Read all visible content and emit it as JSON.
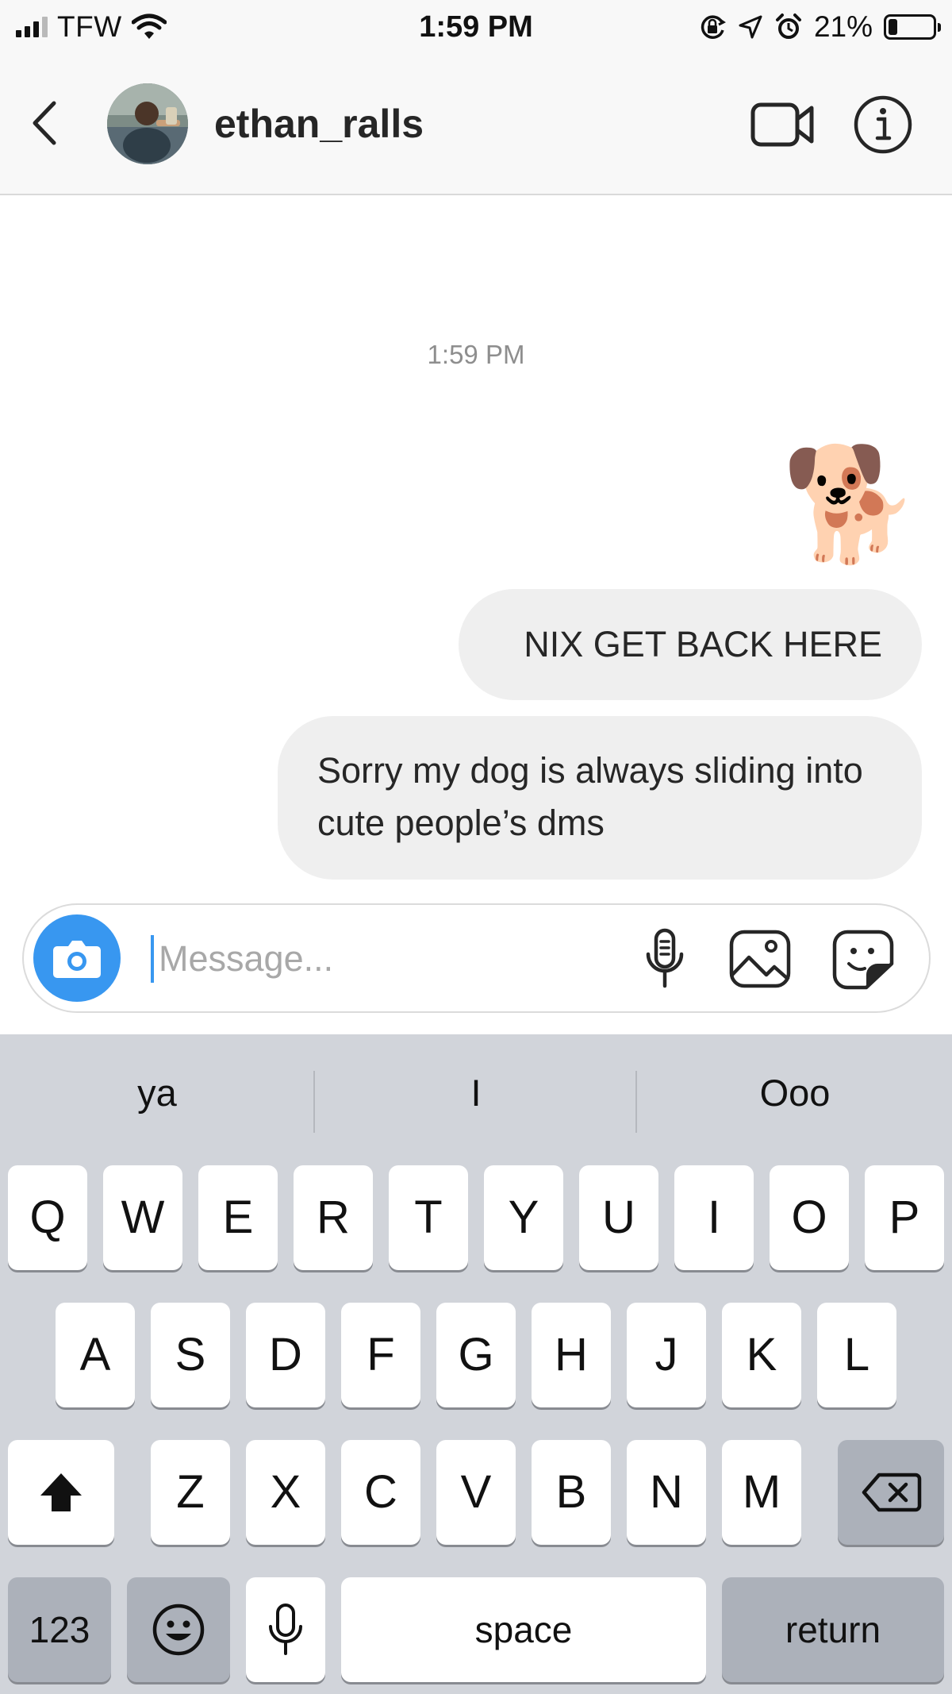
{
  "status_bar": {
    "carrier": "TFW",
    "time": "1:59 PM",
    "battery_percent": "21%",
    "battery_level": 0.21,
    "signal_bars": 3,
    "icons": [
      "wifi-icon",
      "orientation-lock-icon",
      "location-icon",
      "alarm-icon",
      "battery-icon"
    ]
  },
  "header": {
    "username": "ethan_ralls",
    "back_icon": "chevron-left-icon",
    "video_icon": "video-call-icon",
    "info_icon": "info-icon"
  },
  "chat": {
    "timestamp": "1:59 PM",
    "messages": [
      {
        "type": "emoji",
        "text": "🐕"
      },
      {
        "type": "text",
        "text": "NIX GET BACK HERE"
      },
      {
        "type": "text",
        "text": "Sorry my dog is always sliding into cute people’s dms"
      }
    ]
  },
  "composer": {
    "placeholder": "Message...",
    "value": "",
    "camera_icon": "camera-icon",
    "mic_icon": "microphone-icon",
    "gallery_icon": "gallery-icon",
    "sticker_icon": "sticker-icon",
    "accent_color": "#3897f0"
  },
  "keyboard": {
    "suggestions": [
      "ya",
      "I",
      "Ooo"
    ],
    "row1": [
      "Q",
      "W",
      "E",
      "R",
      "T",
      "Y",
      "U",
      "I",
      "O",
      "P"
    ],
    "row2": [
      "A",
      "S",
      "D",
      "F",
      "G",
      "H",
      "J",
      "K",
      "L"
    ],
    "row3": [
      "Z",
      "X",
      "C",
      "V",
      "B",
      "N",
      "M"
    ],
    "numbers_label": "123",
    "space_label": "space",
    "return_label": "return",
    "shift_icon": "shift-icon",
    "delete_icon": "backspace-icon",
    "emoji_icon": "emoji-icon",
    "dictation_icon": "microphone-icon"
  }
}
